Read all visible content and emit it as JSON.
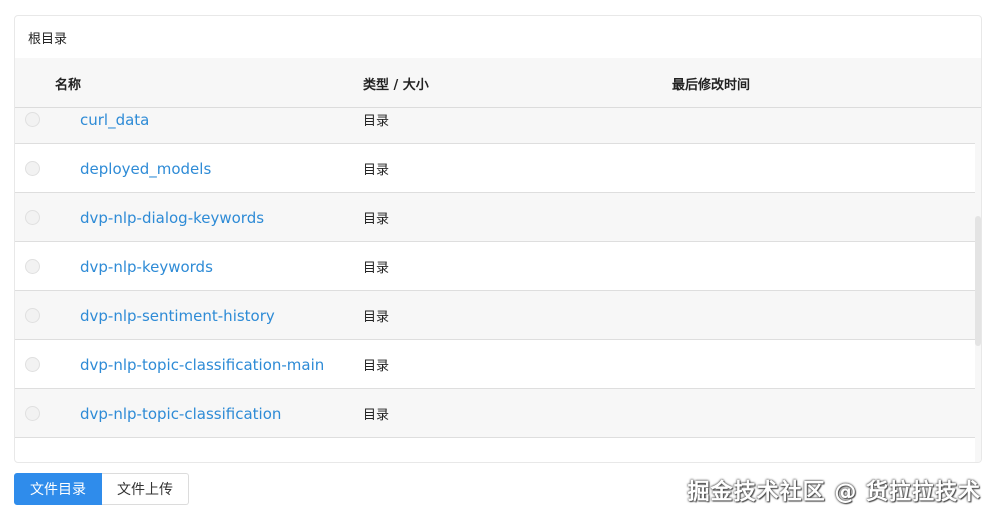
{
  "breadcrumb": "根目录",
  "table": {
    "headers": {
      "name": "名称",
      "type_size": "类型 / 大小",
      "modified": "最后修改时间"
    },
    "rows": [
      {
        "name": "curl_data",
        "type": "目录"
      },
      {
        "name": "deployed_models",
        "type": "目录"
      },
      {
        "name": "dvp-nlp-dialog-keywords",
        "type": "目录"
      },
      {
        "name": "dvp-nlp-keywords",
        "type": "目录"
      },
      {
        "name": "dvp-nlp-sentiment-history",
        "type": "目录"
      },
      {
        "name": "dvp-nlp-topic-classification-main",
        "type": "目录"
      },
      {
        "name": "dvp-nlp-topic-classification",
        "type": "目录"
      }
    ]
  },
  "buttons": {
    "file_directory": "文件目录",
    "file_upload": "文件上传"
  },
  "watermark": "掘金技术社区 @ 货拉拉技术",
  "colors": {
    "accent": "#2f8ceb",
    "link": "#2e8bd6",
    "stripe": "#f7f7f7"
  }
}
